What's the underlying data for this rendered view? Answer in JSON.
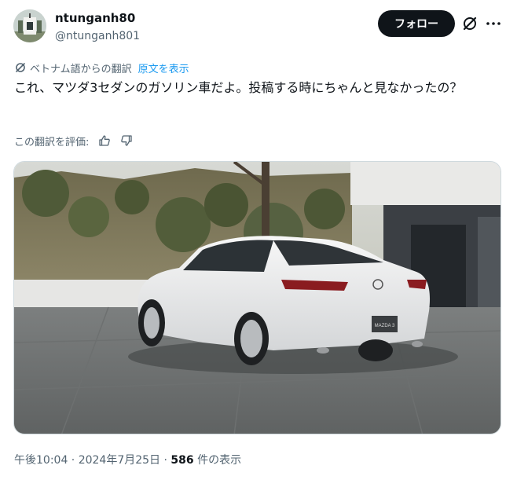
{
  "author": {
    "display_name": "ntunganh80",
    "handle": "@ntunganh801"
  },
  "actions": {
    "follow_label": "フォロー"
  },
  "translation": {
    "note": "ベトナム語からの翻訳",
    "show_original": "原文を表示"
  },
  "tweet": {
    "text": "これ、マツダ3セダンのガソリン車だよ。投稿する時にちゃんと見なかったの？"
  },
  "rating": {
    "label": "この翻訳を評価:"
  },
  "media": {
    "plate_text": "MAZDA 3"
  },
  "meta": {
    "timestamp": "午後10:04 · 2024年7月25日",
    "separator": " · ",
    "views_count": "586",
    "views_label": " 件の表示"
  },
  "icons": {
    "grok": "grok-icon",
    "more": "more-dots-icon",
    "translate": "translate-icon",
    "thumbs_up": "thumbs-up-icon",
    "thumbs_down": "thumbs-down-icon"
  },
  "colors": {
    "text_primary": "#0f1419",
    "text_secondary": "#536471",
    "link": "#1d9bf0",
    "follow_bg": "#0f1419"
  }
}
